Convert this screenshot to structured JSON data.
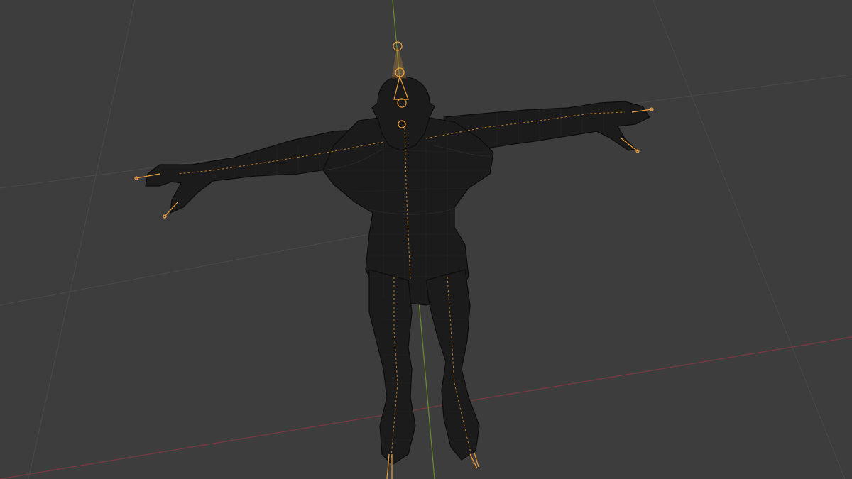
{
  "viewport": {
    "background_color": "#3d3d3d",
    "grid_color": "#4a4a4a",
    "x_axis_color": "#7a3a3f",
    "y_axis_color": "#6d8a2c",
    "mesh_color": "#1b1b1b",
    "armature_color": "#f0a03a",
    "object": "armature-mesh",
    "display_mode": "wireframe"
  }
}
